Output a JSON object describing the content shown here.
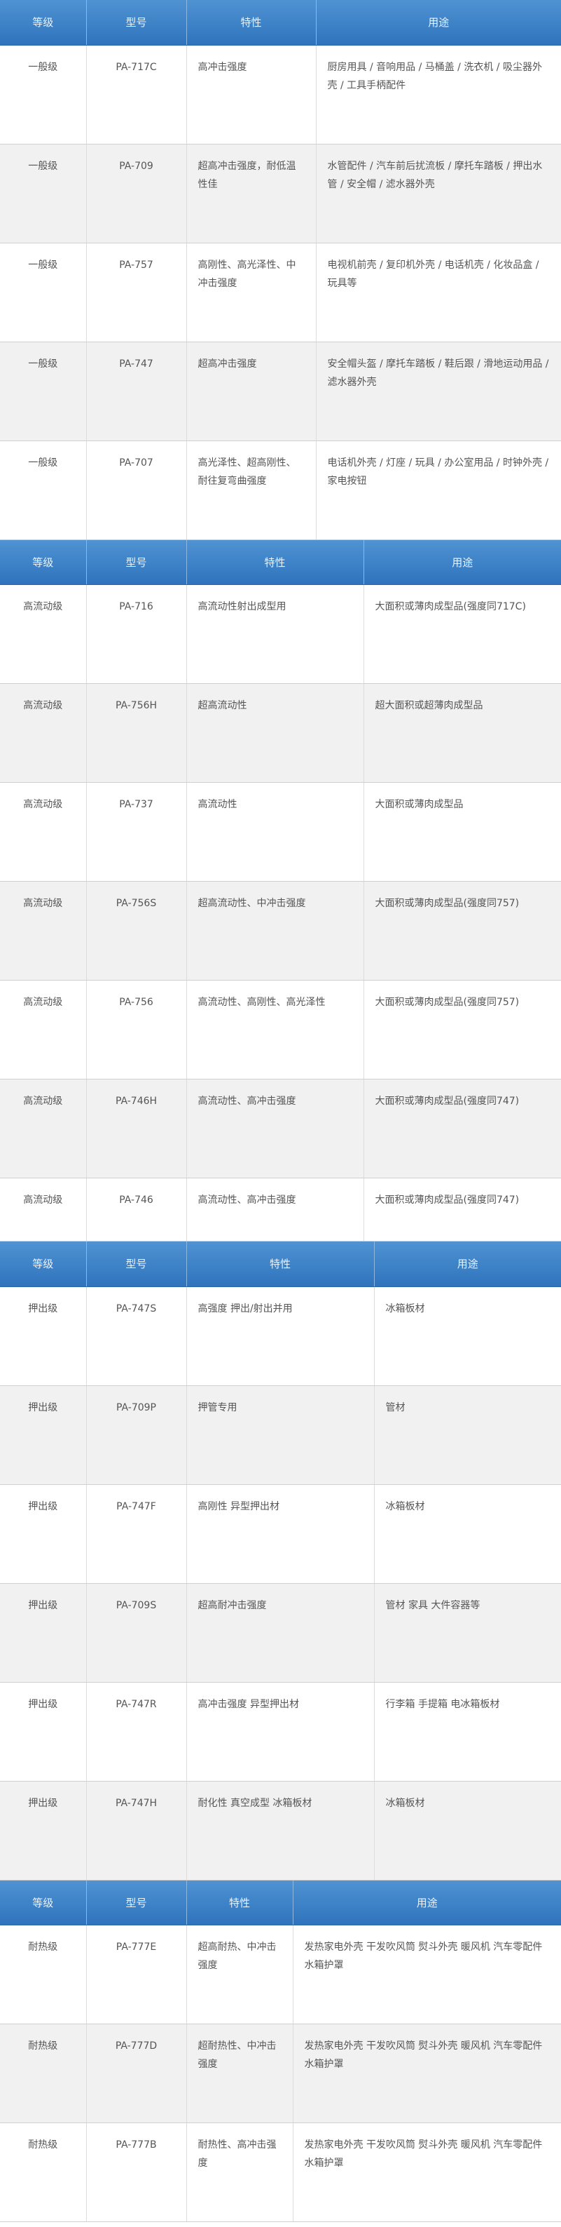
{
  "sections": [
    {
      "headers": [
        "等级",
        "型号",
        "特性",
        "用途"
      ],
      "rows": [
        [
          "一般级",
          "PA-717C",
          "高冲击强度",
          "厨房用具 / 音响用品 / 马桶盖 / 洗衣机 / 吸尘器外壳 / 工具手柄配件"
        ],
        [
          "一般级",
          "PA-709",
          "超高冲击强度，耐低温性佳",
          "水管配件 / 汽车前后扰流板 / 摩托车踏板 / 押出水管 / 安全帽 / 滤水器外壳"
        ],
        [
          "一般级",
          "PA-757",
          "高刚性、高光泽性、中冲击强度",
          "电视机前壳 / 复印机外壳 / 电话机壳 / 化妆品盒 / 玩具等"
        ],
        [
          "一般级",
          "PA-747",
          "超高冲击强度",
          "安全帽头盔 / 摩托车踏板 / 鞋后跟 / 滑地运动用品 / 滤水器外壳"
        ],
        [
          "一般级",
          "PA-707",
          "高光泽性、超高刚性、耐往复弯曲强度",
          "电话机外壳 / 灯座 / 玩具 / 办公室用品 / 时钟外壳 / 家电按钮"
        ]
      ]
    },
    {
      "headers": [
        "等级",
        "型号",
        "特性",
        "用途"
      ],
      "rows": [
        [
          "高流动级",
          "PA-716",
          "高流动性射出成型用",
          "大面积或薄肉成型品(强度同717C)"
        ],
        [
          "高流动级",
          "PA-756H",
          "超高流动性",
          "超大面积或超薄肉成型品"
        ],
        [
          "高流动级",
          "PA-737",
          "高流动性",
          "大面积或薄肉成型品"
        ],
        [
          "高流动级",
          "PA-756S",
          "超高流动性、中冲击强度",
          "大面积或薄肉成型品(强度同757)"
        ],
        [
          "高流动级",
          "PA-756",
          "高流动性、高刚性、高光泽性",
          "大面积或薄肉成型品(强度同757)"
        ],
        [
          "高流动级",
          "PA-746H",
          "高流动性、高冲击强度",
          "大面积或薄肉成型品(强度同747)"
        ],
        [
          "高流动级",
          "PA-746",
          "高流动性、高冲击强度",
          "大面积或薄肉成型品(强度同747)"
        ]
      ]
    },
    {
      "headers": [
        "等级",
        "型号",
        "特性",
        "用途"
      ],
      "rows": [
        [
          "押出级",
          "PA-747S",
          "高强度 押出/射出并用",
          "冰箱板材"
        ],
        [
          "押出级",
          "PA-709P",
          "押管专用",
          "管材"
        ],
        [
          "押出级",
          "PA-747F",
          "高刚性 异型押出材",
          "冰箱板材"
        ],
        [
          "押出级",
          "PA-709S",
          "超高耐冲击强度",
          "管材 家具 大件容器等"
        ],
        [
          "押出级",
          "PA-747R",
          "高冲击强度 异型押出材",
          "行李箱 手提箱 电冰箱板材"
        ],
        [
          "押出级",
          "PA-747H",
          "耐化性 真空成型 冰箱板材",
          "冰箱板材"
        ]
      ]
    },
    {
      "headers": [
        "等级",
        "型号",
        "特性",
        "用途"
      ],
      "rows": [
        [
          "耐热级",
          "PA-777E",
          "超高耐热、中冲击强度",
          "发热家电外壳 干发吹风筒 熨斗外壳 暖风机 汽车零配件 水箱护罩"
        ],
        [
          "耐热级",
          "PA-777D",
          "超耐热性、中冲击强度",
          "发热家电外壳 干发吹风筒 熨斗外壳 暖风机 汽车零配件 水箱护罩"
        ],
        [
          "耐热级",
          "PA-777B",
          "耐热性、高冲击强度",
          "发热家电外壳 干发吹风筒 熨斗外壳 暖风机 汽车零配件 水箱护罩"
        ]
      ]
    }
  ]
}
